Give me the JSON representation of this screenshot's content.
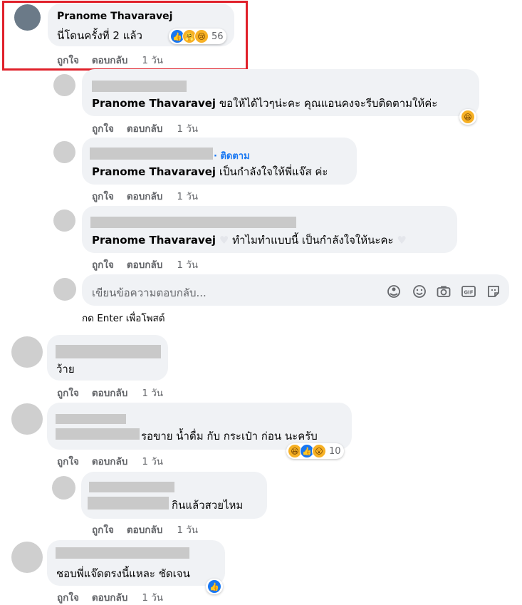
{
  "thread": {
    "main": {
      "author": "Pranome Thavaravej",
      "text": "นี่โดนครั้งที่ 2 แล้ว",
      "reaction_count": "56",
      "reactions": [
        "like-icon",
        "care-icon",
        "sad-icon"
      ]
    },
    "replies": [
      {
        "author": "Pranome Thavaravej",
        "text": "ขอให้ได้ไวๆน่ะคะ คุณแอนคงจะรีบติดตามให้ค่ะ"
      },
      {
        "follow_label": "· ติดตาม",
        "author": "Pranome Thavaravej",
        "text": "เป็นกำลังใจให้พี่แจ๊ส ค่ะ"
      },
      {
        "author": "Pranome Thavaravej",
        "text": "ทำไมทำแบบนี้ เป็นกำลังใจให้นะคะ"
      }
    ],
    "reply_input": {
      "placeholder": "เขียนข้อความตอบกลับ...",
      "hint": "กด Enter เพื่อโพสต์"
    },
    "comments": [
      {
        "text": "ว้าย"
      },
      {
        "text": "รอขาย น้ำดื่ม กับ กระเป๋า ก่อน นะครับ",
        "reaction_count": "10",
        "reactions": [
          "haha-icon",
          "like-icon",
          "wow-icon"
        ]
      },
      {
        "text": "กินแล้วสวยไหม"
      },
      {
        "text": "ชอบพี่แจ๊ดตรงนี้แหละ ชัดเจน"
      }
    ]
  },
  "actions": {
    "like": "ถูกใจ",
    "reply": "ตอบกลับ",
    "time": "1 วัน"
  },
  "colors": {
    "highlight": "#e0202a",
    "bubble": "#f0f2f5",
    "action_text": "#65676b",
    "link_blue": "#1877f2"
  }
}
